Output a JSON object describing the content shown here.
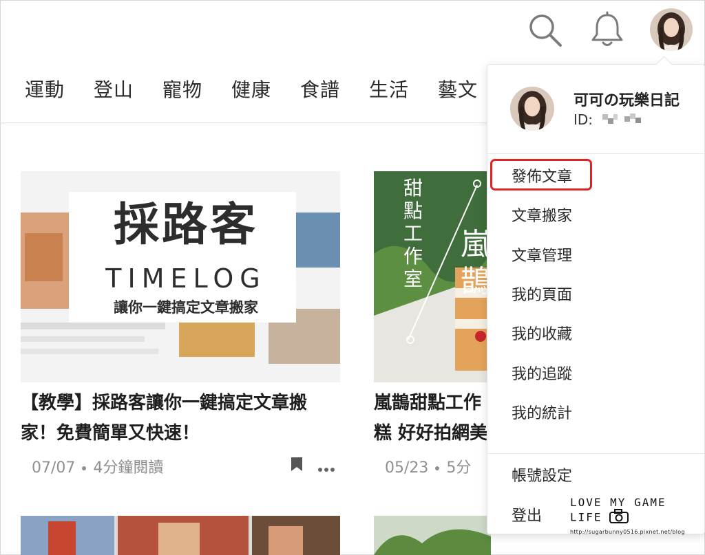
{
  "header": {
    "icons": [
      "search-icon",
      "bell-icon",
      "avatar"
    ]
  },
  "categories": [
    "運動",
    "登山",
    "寵物",
    "健康",
    "食譜",
    "生活",
    "藝文"
  ],
  "cards": [
    {
      "thumb_title": "採路客",
      "thumb_sub": "TIMELOG",
      "thumb_caption": "讓你一鍵搞定文章搬家",
      "title_line1": "【教學】採路客讓你一鍵搞定文章搬",
      "title_line2": "家！免費簡單又快速！",
      "date": "07/07",
      "read_time": "4分鐘閱讀"
    },
    {
      "thumb_vertical": "甜點工作室",
      "thumb_big": "嵐鵲",
      "title_line1": "嵐鵲甜點工作",
      "title_line2": "糕 好好拍網美",
      "date": "05/23",
      "read_time": "5分"
    }
  ],
  "dropdown": {
    "user_name": "可可の玩樂日記",
    "user_id": "ID:",
    "menu": [
      "發佈文章",
      "文章搬家",
      "文章管理",
      "我的頁面",
      "我的收藏",
      "我的追蹤",
      "我的統計"
    ],
    "account_settings": "帳號設定",
    "logout": "登出"
  },
  "watermark": {
    "text": "LOVE MY GAME LIFE",
    "url": "http://sugarbunny0516.pixnet.net/blog"
  },
  "colors": {
    "highlight": "#e02424",
    "text": "#2a2a2a",
    "meta": "#8f8f8f"
  }
}
